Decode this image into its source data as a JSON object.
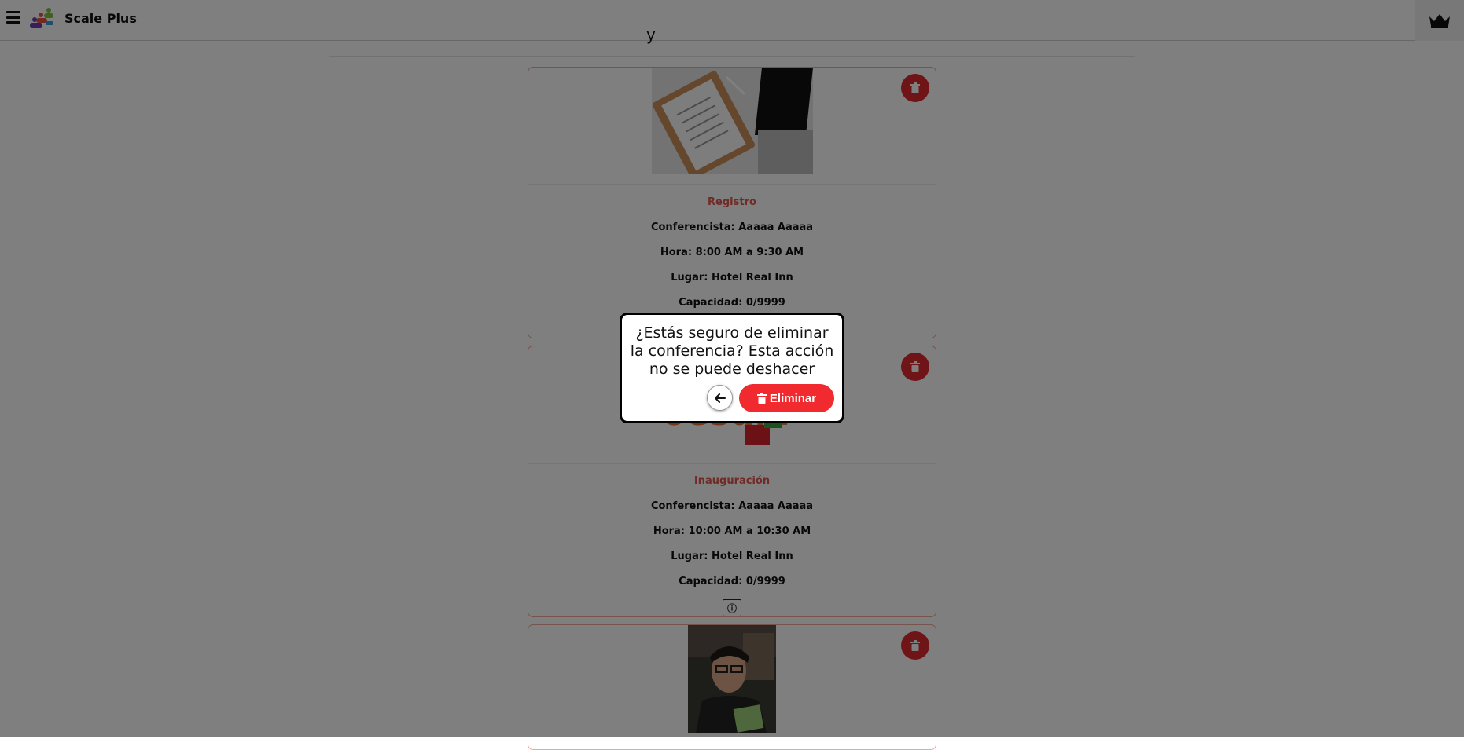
{
  "header": {
    "brand": "Scale Plus"
  },
  "page": {
    "heading_fragment": "y"
  },
  "cards": [
    {
      "title": "Registro",
      "speaker": "Conferencista: Aaaaa Aaaaa",
      "time": "Hora: 8:00 AM a 9:30 AM",
      "place": "Lugar: Hotel Real Inn",
      "capacity": "Capacidad: 0/9999",
      "image": "clipboard-laptop-photo"
    },
    {
      "title": "Inauguración",
      "speaker": "Conferencista: Aaaaa Aaaaa",
      "time": "Hora: 10:00 AM a 10:30 AM",
      "place": "Lugar: Hotel Real Inn",
      "capacity": "Capacidad: 0/9999",
      "image": "colorful-logo-blocks"
    },
    {
      "image": "speaker-portrait-photo"
    }
  ],
  "info_icon_glyph": "ⓘ",
  "dialog": {
    "message": "¿Estás seguro de eliminar la conferencia? Esta acción no se puede deshacer",
    "confirm_label": "Eliminar"
  },
  "colors": {
    "accent_red": "#e12a2f",
    "card_border": "#f2a69a",
    "title_orange": "#e2574c",
    "overlay": "rgba(0,0,0,0.5)"
  }
}
